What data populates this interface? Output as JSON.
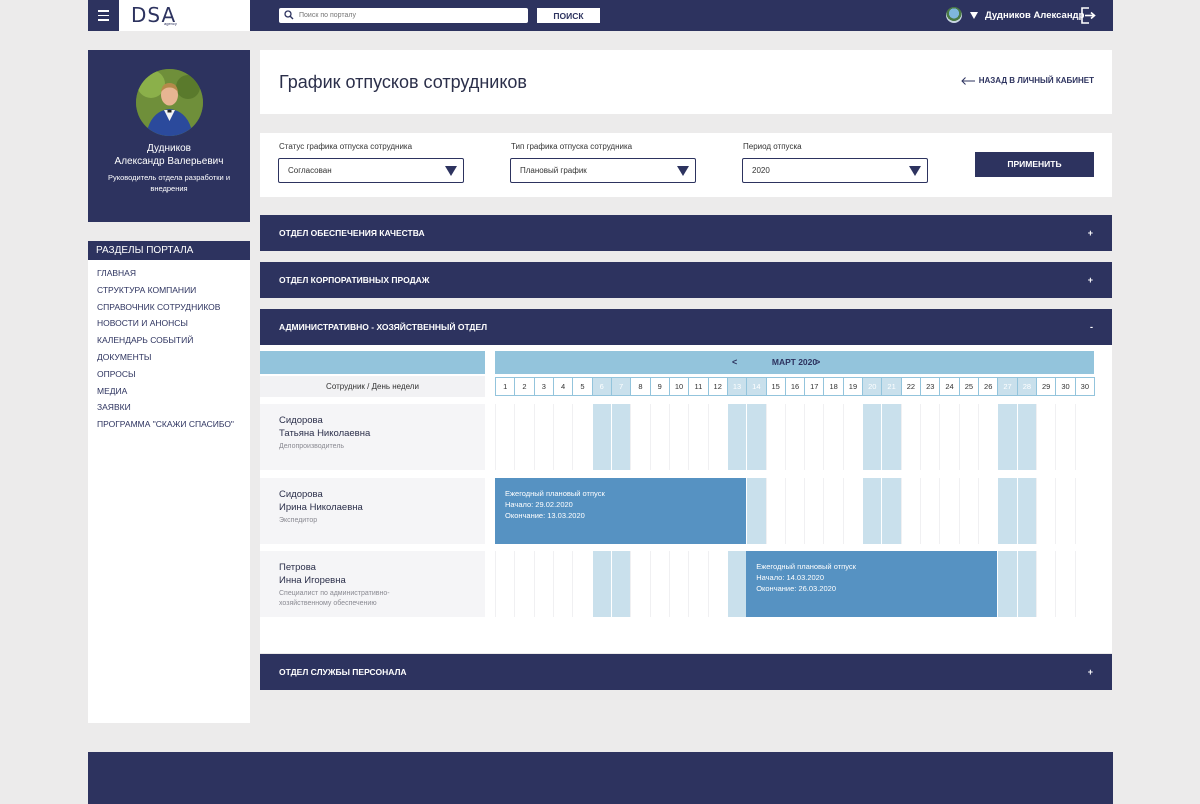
{
  "header": {
    "logo_text": "DSA",
    "logo_sub": "agency",
    "search_placeholder": "Поиск по порталу",
    "search_button": "ПОИСК",
    "user_name": "Дудников Александр"
  },
  "profile": {
    "name_line1": "Дудников",
    "name_line2": "Александр Валерьевич",
    "role": "Руководитель отдела разработки и внедрения"
  },
  "sections": {
    "title": "РАЗДЕЛЫ ПОРТАЛА",
    "items": [
      "ГЛАВНАЯ",
      "СТРУКТУРА КОМПАНИИ",
      "СПРАВОЧНИК СОТРУДНИКОВ",
      "НОВОСТИ И АНОНСЫ",
      "КАЛЕНДАРЬ СОБЫТИЙ",
      "ДОКУМЕНТЫ",
      "ОПРОСЫ",
      "МЕДИА",
      "ЗАЯВКИ",
      "ПРОГРАММА \"СКАЖИ СПАСИБО\""
    ]
  },
  "page": {
    "title": "График отпусков сотрудников",
    "back_link": "НАЗАД В ЛИЧНЫЙ КАБИНЕТ"
  },
  "filters": {
    "status_label": "Статус графика отпуска сотрудника",
    "status_value": "Согласован",
    "type_label": "Тип графика отпуска сотрудника",
    "type_value": "Плановый график",
    "period_label": "Период отпуска",
    "period_value": "2020",
    "apply_button": "ПРИМЕНИТЬ"
  },
  "departments": [
    {
      "name": "ОТДЕЛ ОБЕСПЕЧЕНИЯ КАЧЕСТВА",
      "toggle": "+"
    },
    {
      "name": "ОТДЕЛ КОРПОРАТИВНЫХ ПРОДАЖ",
      "toggle": "+"
    },
    {
      "name": "АДМИНИСТРАТИВНО - ХОЗЯЙСТВЕННЫЙ ОТДЕЛ",
      "toggle": "-"
    },
    {
      "name": "ОТДЕЛ СЛУЖБЫ ПЕРСОНАЛА",
      "toggle": "+"
    }
  ],
  "calendar": {
    "prev": "<",
    "month": "МАРТ 2020",
    "next": ">",
    "column_header": "Сотрудник / День недели",
    "days": [
      "1",
      "2",
      "3",
      "4",
      "5",
      "6",
      "7",
      "8",
      "9",
      "10",
      "11",
      "12",
      "13",
      "14",
      "15",
      "16",
      "17",
      "18",
      "19",
      "20",
      "21",
      "22",
      "23",
      "24",
      "25",
      "26",
      "27",
      "28",
      "29",
      "30",
      "30"
    ],
    "weekend_days": [
      6,
      7,
      13,
      14,
      20,
      21,
      27,
      28
    ],
    "employees": [
      {
        "name_line1": "Сидорова",
        "name_line2": "Татьяна Николаевна",
        "position": "Делопроизводитель"
      },
      {
        "name_line1": "Сидорова",
        "name_line2": "Ирина Николаевна",
        "position": "Экспедитор"
      },
      {
        "name_line1": "Петрова",
        "name_line2": "Инна Игоревна",
        "position": "Специалист по административно-хозяйственному обеспечению"
      }
    ],
    "vacations": [
      {
        "employee_index": 1,
        "title": "Ежегодный плановый отпуск",
        "start": "Начало: 29.02.2020",
        "end": "Окончание: 13.03.2020",
        "first_day": 1,
        "last_day": 13
      },
      {
        "employee_index": 2,
        "title": "Ежегодный плановый отпуск",
        "start": "Начало: 14.03.2020",
        "end": "Окончание: 26.03.2020",
        "first_day": 14,
        "last_day": 26
      }
    ]
  },
  "colors": {
    "navy": "#2d335f",
    "light_blue": "#93c4dc",
    "weekend": "#c9e0ec",
    "vacation": "#5692c2",
    "background": "#ecebeb"
  }
}
